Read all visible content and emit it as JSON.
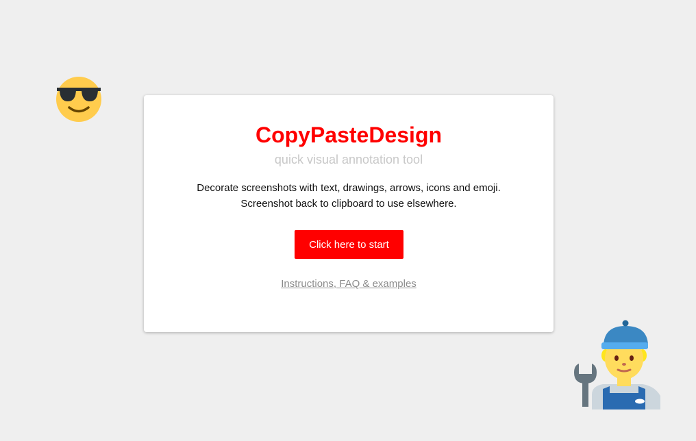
{
  "app": {
    "title": "CopyPasteDesign",
    "tagline": "quick visual annotation tool",
    "description_lines": [
      "Decorate screenshots with text, drawings, arrows, icons and emoji.",
      "Screenshot back to clipboard to use elsewhere."
    ],
    "start_button_label": "Click here to start",
    "help_link_label": "Instructions, FAQ & examples"
  },
  "decorations": {
    "top_left_icon": "sunglasses-face-emoji",
    "bottom_right_icon": "mechanic-emoji"
  },
  "colors": {
    "background": "#efefef",
    "accent": "#ff0000",
    "tagline": "#c8c8c8",
    "link": "#8c8c8c"
  }
}
